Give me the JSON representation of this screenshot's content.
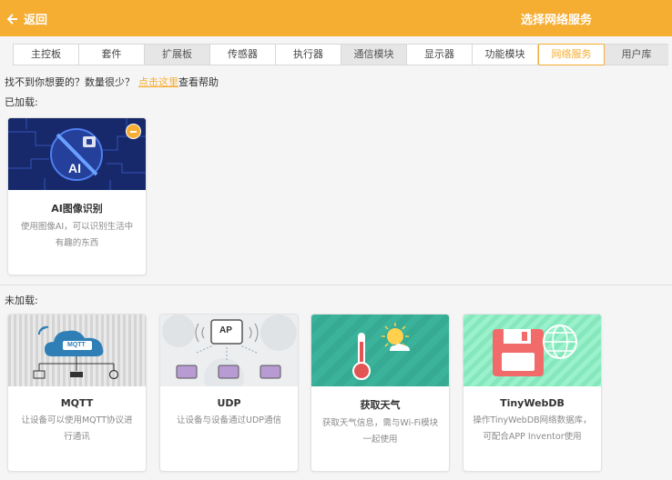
{
  "header": {
    "back_label": "返回",
    "title": "选择网络服务"
  },
  "tabs": [
    {
      "label": "主控板"
    },
    {
      "label": "套件"
    },
    {
      "label": "扩展板"
    },
    {
      "label": "传感器"
    },
    {
      "label": "执行器"
    },
    {
      "label": "通信模块"
    },
    {
      "label": "显示器"
    },
    {
      "label": "功能模块"
    },
    {
      "label": "网络服务"
    },
    {
      "label": "用户库"
    }
  ],
  "help": {
    "text": "找不到你想要的？数量很少？",
    "link": "点击这里",
    "suffix": "查看帮助"
  },
  "loaded_label": "已加载:",
  "unloaded_label": "未加载:",
  "loaded": [
    {
      "name": "AI图像识别",
      "desc": "使用图像AI，可以识别生活中有趣的东西",
      "thumb_text": "AI"
    }
  ],
  "unloaded": [
    {
      "name": "MQTT",
      "desc": "让设备可以使用MQTT协议进行通讯",
      "thumb_text": "MQTT"
    },
    {
      "name": "UDP",
      "desc": "让设备与设备通过UDP通信",
      "thumb_text": "AP"
    },
    {
      "name": "获取天气",
      "desc": "获取天气信息，需与Wi-Fi模块一起使用"
    },
    {
      "name": "TinyWebDB",
      "desc": "操作TinyWebDB网络数据库，可配合APP Inventor使用"
    }
  ],
  "colors": {
    "accent": "#f5ad32",
    "ai_bg": "#1a2b6e",
    "weather_bg": "#3bb39a",
    "db_bg": "#93f0c8"
  }
}
